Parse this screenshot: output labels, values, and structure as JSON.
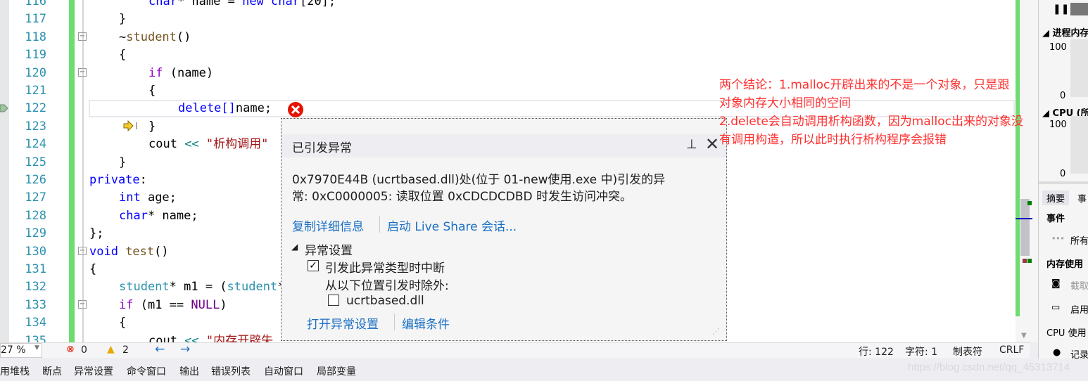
{
  "editor": {
    "lines": [
      {
        "num": "116",
        "indent": 2,
        "tokens": [
          [
            "kw",
            "char"
          ],
          [
            "",
            "* name = "
          ],
          [
            "kw",
            "new"
          ],
          [
            "",
            ""
          ],
          [
            "kw",
            " char"
          ],
          [
            "",
            "[20];"
          ]
        ]
      },
      {
        "num": "117",
        "indent": 1,
        "tokens": [
          [
            "",
            "}"
          ]
        ]
      },
      {
        "num": "118",
        "indent": 1,
        "tokens": [
          [
            "",
            "~"
          ],
          [
            "fn",
            "student"
          ],
          [
            "",
            "()"
          ]
        ]
      },
      {
        "num": "119",
        "indent": 1,
        "tokens": [
          [
            "",
            "{"
          ]
        ]
      },
      {
        "num": "120",
        "indent": 2,
        "tokens": [
          [
            "kw2",
            "if"
          ],
          [
            "",
            " (name)"
          ]
        ]
      },
      {
        "num": "121",
        "indent": 2,
        "tokens": [
          [
            "",
            "{"
          ]
        ]
      },
      {
        "num": "122",
        "indent": 3,
        "tokens": [
          [
            "kw",
            "delete[]"
          ],
          [
            "",
            "name;"
          ]
        ]
      },
      {
        "num": "123",
        "indent": 2,
        "tokens": [
          [
            "",
            "}"
          ]
        ]
      },
      {
        "num": "124",
        "indent": 2,
        "tokens": [
          [
            "",
            "cout "
          ],
          [
            "op",
            "<<"
          ],
          [
            "str",
            " \"析构调用\""
          ]
        ]
      },
      {
        "num": "125",
        "indent": 1,
        "tokens": [
          [
            "",
            "}"
          ]
        ]
      },
      {
        "num": "126",
        "indent": 0,
        "tokens": [
          [
            "kw",
            "private"
          ],
          [
            "",
            ":"
          ]
        ]
      },
      {
        "num": "127",
        "indent": 1,
        "tokens": [
          [
            "kw",
            "int"
          ],
          [
            "",
            " age;"
          ]
        ]
      },
      {
        "num": "128",
        "indent": 1,
        "tokens": [
          [
            "kw",
            "char"
          ],
          [
            "",
            "* name;"
          ]
        ]
      },
      {
        "num": "129",
        "indent": 0,
        "tokens": [
          [
            "",
            "};"
          ]
        ]
      },
      {
        "num": "130",
        "indent": 0,
        "tokens": [
          [
            "kw",
            "void"
          ],
          [
            "fn",
            " test"
          ],
          [
            "",
            "()"
          ]
        ]
      },
      {
        "num": "131",
        "indent": 0,
        "tokens": [
          [
            "",
            "{"
          ]
        ]
      },
      {
        "num": "132",
        "indent": 1,
        "tokens": [
          [
            "ty",
            "student"
          ],
          [
            "",
            "* m1 = ("
          ],
          [
            "ty",
            "student"
          ],
          [
            "",
            "*"
          ]
        ]
      },
      {
        "num": "133",
        "indent": 1,
        "tokens": [
          [
            "kw2",
            "if"
          ],
          [
            "",
            " (m1 == "
          ],
          [
            "mac",
            "NULL"
          ],
          [
            "",
            ")"
          ]
        ]
      },
      {
        "num": "134",
        "indent": 1,
        "tokens": [
          [
            "",
            "{"
          ]
        ]
      },
      {
        "num": "135",
        "indent": 2,
        "tokens": [
          [
            "",
            "cout "
          ],
          [
            "op",
            "<<"
          ],
          [
            "str",
            " \"内存开辟失"
          ]
        ]
      }
    ]
  },
  "popup": {
    "title": "已引发异常",
    "message_line1": "0x7970E44B (ucrtbased.dll)处(位于 01-new使用.exe 中)引发的异",
    "message_line2": "常: 0xC0000005: 读取位置 0xCDCDCDBD 时发生访问冲突。",
    "link_copy": "复制详细信息",
    "link_liveshare": "启动 Live Share 会话...",
    "section": "异常设置",
    "break_checkbox": {
      "label": "引发此异常类型时中断",
      "checked": true
    },
    "except_label": "从以下位置引发时除外:",
    "dll_checkbox": {
      "label": "ucrtbased.dll",
      "checked": false
    },
    "link_open": "打开异常设置",
    "link_edit": "编辑条件"
  },
  "note": {
    "line1": "两个结论：1.malloc开辟出来的不是一个对象，只是跟",
    "line2": "对象内存大小相同的空间",
    "line3": "2.delete会自动调用析构函数，因为malloc出来的对象没",
    "line4": "有调用构造，所以此时执行析构程序会报错",
    "color": "#ff3030"
  },
  "statusbar": {
    "zoom": "27 %",
    "errors": "0",
    "warnings": "2",
    "line": "行: 122",
    "char": "字符: 1",
    "tabs": "制表符",
    "eol": "CRLF"
  },
  "bottom_tabs": [
    "用堆栈",
    "断点",
    "异常设置",
    "命令窗口",
    "输出",
    "错误列表",
    "自动窗口",
    "局部变量"
  ],
  "watermark": "https://blog.csdn.net/qq_45313714",
  "diag": {
    "mem_title": "进程内存",
    "mem_max": "100",
    "mem_min": "0",
    "cpu_title": "CPU (所",
    "cpu_max": "100",
    "cpu_min": "0",
    "tab_summary": "摘要",
    "tab_events": "事",
    "events": "事件",
    "all_events": "所有",
    "mem_usage": "内存使用",
    "snapshot": "截取",
    "enable": "启用",
    "cpu_usage": "CPU 使用",
    "record": "记录"
  }
}
